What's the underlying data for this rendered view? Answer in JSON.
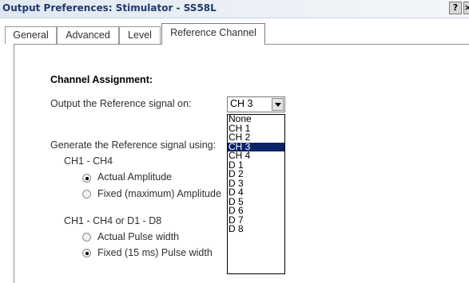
{
  "window": {
    "title": "Output Preferences:  Stimulator - SS58L",
    "help_label": "?",
    "close_label": "×"
  },
  "tabs": [
    {
      "label": "General"
    },
    {
      "label": "Advanced"
    },
    {
      "label": "Level"
    },
    {
      "label": "Reference Channel",
      "active": true
    }
  ],
  "panel": {
    "heading": "Channel Assignment:",
    "output_label": "Output the Reference signal on:",
    "combo": {
      "value": "CH 3",
      "options": [
        "None",
        "CH 1",
        "CH 2",
        "CH 3",
        "CH 4",
        "D 1",
        "D 2",
        "D 3",
        "D 4",
        "D 5",
        "D 6",
        "D 7",
        "D 8"
      ],
      "selected_index": 3
    },
    "generate_label": "Generate the Reference signal using:",
    "amp_group": {
      "label": "CH1 - CH4",
      "options": [
        {
          "label": "Actual Amplitude",
          "checked": true
        },
        {
          "label": "Fixed (maximum) Amplitude",
          "checked": false
        }
      ]
    },
    "pulse_group": {
      "label": "CH1 - CH4 or D1 - D8",
      "options": [
        {
          "label": "Actual Pulse width",
          "checked": false
        },
        {
          "label": "Fixed (15 ms) Pulse width",
          "checked": true
        }
      ]
    }
  },
  "colors": {
    "title_text": "#1e3a6d",
    "selection_bg": "#0a246a"
  }
}
